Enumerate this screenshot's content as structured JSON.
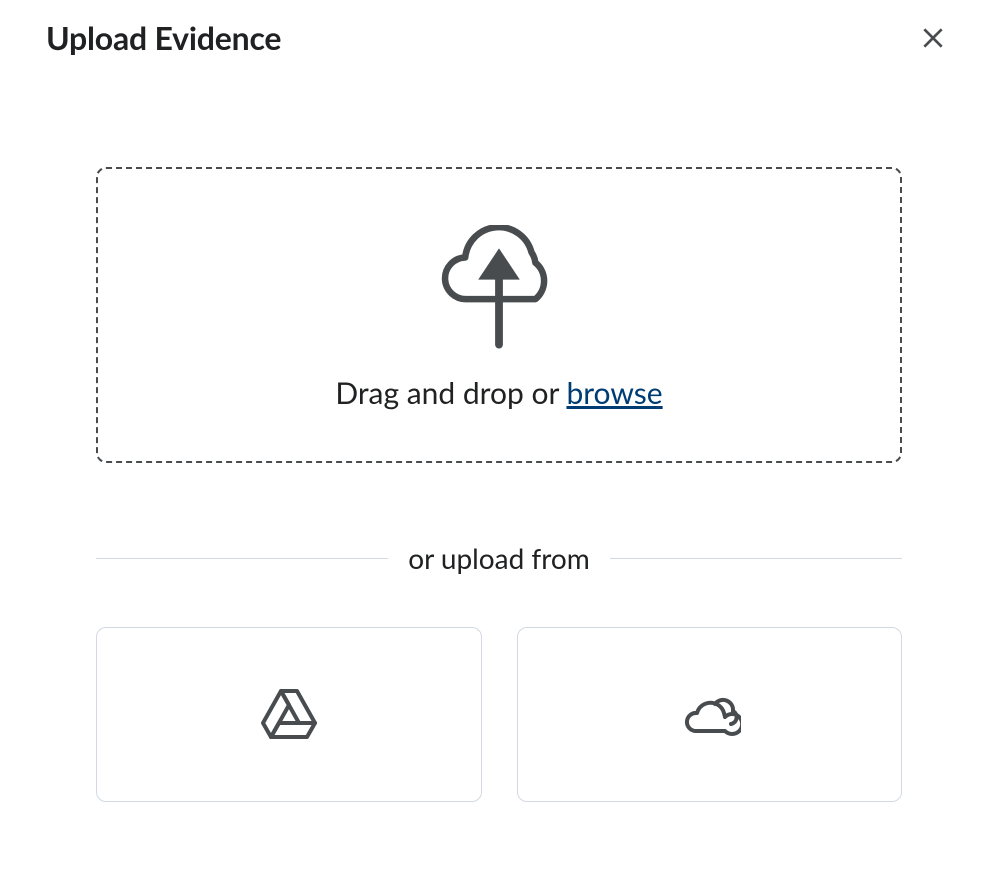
{
  "header": {
    "title": "Upload Evidence"
  },
  "upload": {
    "drag_text": "Drag and drop or ",
    "browse_label": "browse",
    "divider_label": "or upload from",
    "providers": [
      {
        "name": "google-drive"
      },
      {
        "name": "cloud-storage"
      }
    ]
  }
}
